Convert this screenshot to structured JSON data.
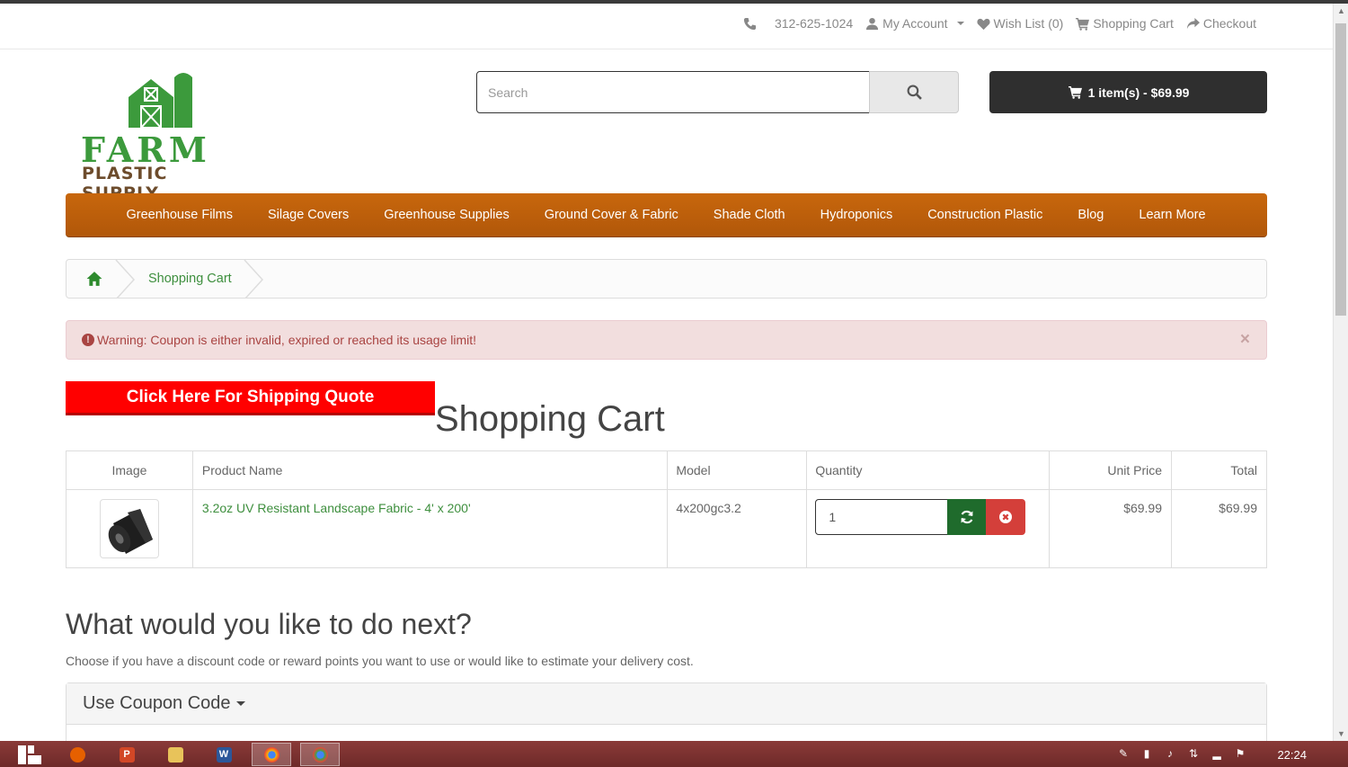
{
  "topbar": {
    "phone": "312-625-1024",
    "my_account": "My Account",
    "wish_list": "Wish List (0)",
    "shopping_cart": "Shopping Cart",
    "checkout": "Checkout"
  },
  "logo": {
    "line1": "FARM",
    "line2": "PLASTIC SUPPLY"
  },
  "search": {
    "placeholder": "Search"
  },
  "cart_button": {
    "label": "1 item(s) - $69.99"
  },
  "nav": {
    "items": [
      "Greenhouse Films",
      "Silage Covers",
      "Greenhouse Supplies",
      "Ground Cover & Fabric",
      "Shade Cloth",
      "Hydroponics",
      "Construction Plastic",
      "Blog",
      "Learn More"
    ]
  },
  "breadcrumb": {
    "current": "Shopping Cart"
  },
  "alert": {
    "text": "Warning: Coupon is either invalid, expired or reached its usage limit!",
    "close": "×"
  },
  "shipping_quote": {
    "label": "Click Here For Shipping Quote"
  },
  "page_title": "Shopping Cart",
  "cart": {
    "headers": {
      "image": "Image",
      "name": "Product Name",
      "model": "Model",
      "quantity": "Quantity",
      "unit_price": "Unit Price",
      "total": "Total"
    },
    "rows": [
      {
        "name": "3.2oz UV Resistant Landscape Fabric - 4' x 200'",
        "model": "4x200gc3.2",
        "quantity": "1",
        "unit_price": "$69.99",
        "total": "$69.99"
      }
    ]
  },
  "next": {
    "title": "What would you like to do next?",
    "description": "Choose if you have a discount code or reward points you want to use or would like to estimate your delivery cost."
  },
  "coupon_panel": {
    "title": "Use Coupon Code"
  },
  "taskbar": {
    "clock": "22:24"
  },
  "colors": {
    "nav": "#c8670c",
    "link": "#3e8f3e",
    "alert_bg": "#f2dede",
    "quote": "#ff0000",
    "update": "#1f6b2c",
    "remove": "#d43f3a"
  }
}
